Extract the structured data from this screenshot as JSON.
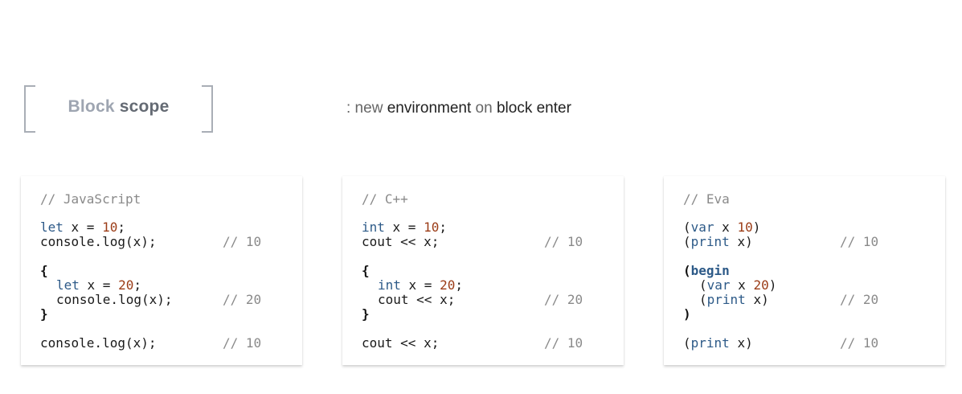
{
  "header": {
    "title_word1": "Block",
    "title_word2": "scope",
    "subtitle_prefix": ": new",
    "subtitle_word1": "environment",
    "subtitle_on": "on",
    "subtitle_word2": "block enter"
  },
  "panels": [
    {
      "heading": "// JavaScript",
      "lines": {
        "l1_kw": "let",
        "l1_mid": " x = ",
        "l1_num": "10",
        "l1_end": ";",
        "l2": "console.log(x);",
        "l3": "{",
        "l4_kw": "let",
        "l4_mid": " x = ",
        "l4_num": "20",
        "l4_end": ";",
        "l5": "console.log(x);",
        "l6": "}",
        "l7": "console.log(x);"
      },
      "comments": [
        "// 10",
        "// 20",
        "// 10"
      ]
    },
    {
      "heading": "// C++",
      "lines": {
        "l1_kw": "int",
        "l1_mid": " x = ",
        "l1_num": "10",
        "l1_end": ";",
        "l2": "cout << x;",
        "l3": "{",
        "l4_kw": "int",
        "l4_mid": " x = ",
        "l4_num": "20",
        "l4_end": ";",
        "l5": "cout << x;",
        "l6": "}",
        "l7": "cout << x;"
      },
      "comments": [
        "// 10",
        "// 20",
        "// 10"
      ]
    },
    {
      "heading": "// Eva",
      "lines": {
        "l1_open": "(",
        "l1_kw": "var",
        "l1_mid": " x ",
        "l1_num": "10",
        "l1_end": ")",
        "l2_open": "(",
        "l2_kw": "print",
        "l2_end": " x)",
        "l3_open": "(",
        "l3_kw": "begin",
        "l4_open": "(",
        "l4_kw": "var",
        "l4_mid": " x ",
        "l4_num": "20",
        "l4_end": ")",
        "l5_open": "(",
        "l5_kw": "print",
        "l5_end": " x)",
        "l6": ")",
        "l7_open": "(",
        "l7_kw": "print",
        "l7_end": " x)"
      },
      "comments": [
        "// 10",
        "// 20",
        "// 10"
      ]
    }
  ]
}
